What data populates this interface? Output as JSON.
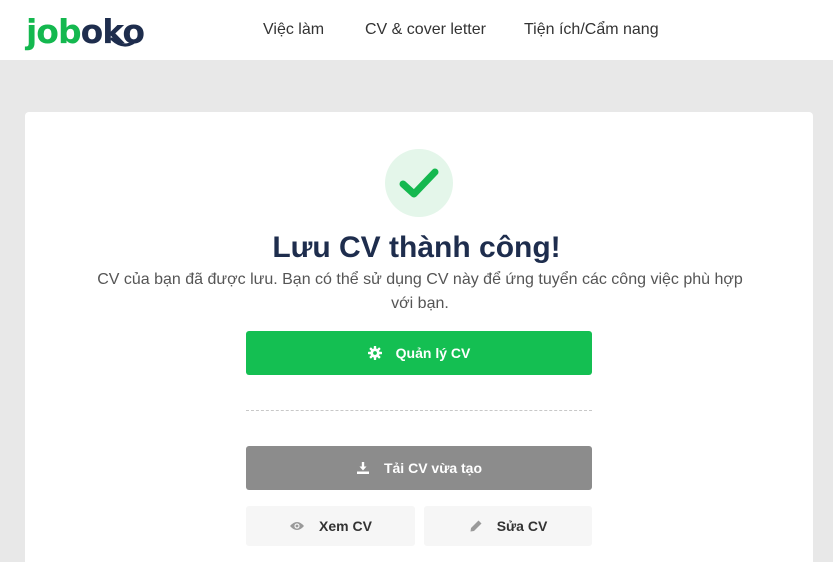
{
  "brand": {
    "logo_part1": "job",
    "logo_part2": "oko",
    "primary_color": "#14b84f",
    "navy_color": "#1e2d4d"
  },
  "nav": {
    "items": [
      {
        "label": "Việc làm"
      },
      {
        "label": "CV & cover letter"
      },
      {
        "label": "Tiện ích/Cẩm nang"
      }
    ]
  },
  "success": {
    "icon": "check-icon",
    "title": "Lưu CV thành công!",
    "description": "CV của bạn đã được lưu. Bạn có thể sử dụng CV này để ứng tuyển các công việc phù hợp với bạn."
  },
  "actions": {
    "manage": {
      "label": "Quản lý CV",
      "icon": "gear-icon",
      "color": "#14bf52"
    },
    "download": {
      "label": "Tải CV vừa tạo",
      "icon": "download-icon",
      "color": "#8c8c8c"
    },
    "view": {
      "label": "Xem CV",
      "icon": "eye-icon"
    },
    "edit": {
      "label": "Sửa CV",
      "icon": "pencil-icon"
    }
  }
}
